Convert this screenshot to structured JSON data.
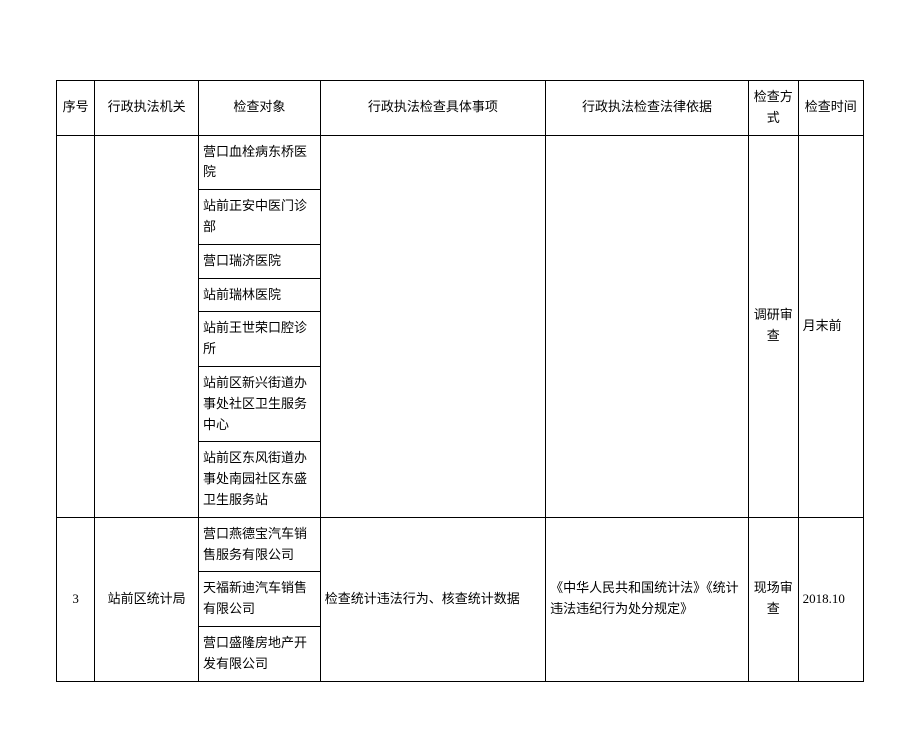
{
  "headers": {
    "seq": "序号",
    "agency": "行政执法机关",
    "target": "检查对象",
    "matters": "行政执法检查具体事项",
    "basis": "行政执法检查法律依据",
    "method": "检查方式",
    "time": "检查时间"
  },
  "group1": {
    "targets": [
      "营口血栓病东桥医院",
      "站前正安中医门诊部",
      "营口瑞济医院",
      "站前瑞林医院",
      "站前王世荣口腔诊所",
      "站前区新兴街道办事处社区卫生服务中心",
      "站前区东风街道办事处南园社区东盛卫生服务站"
    ],
    "method": "调研审查",
    "time": "月末前"
  },
  "group2": {
    "seq": "3",
    "agency": "站前区统计局",
    "targets": [
      "营口燕德宝汽车销售服务有限公司",
      "天福新迪汽车销售有限公司",
      "营口盛隆房地产开发有限公司"
    ],
    "matters": "检查统计违法行为、核查统计数据",
    "basis": "《中华人民共和国统计法》《统计违法违纪行为处分规定》",
    "method": "现场审查",
    "time": "2018.10"
  }
}
